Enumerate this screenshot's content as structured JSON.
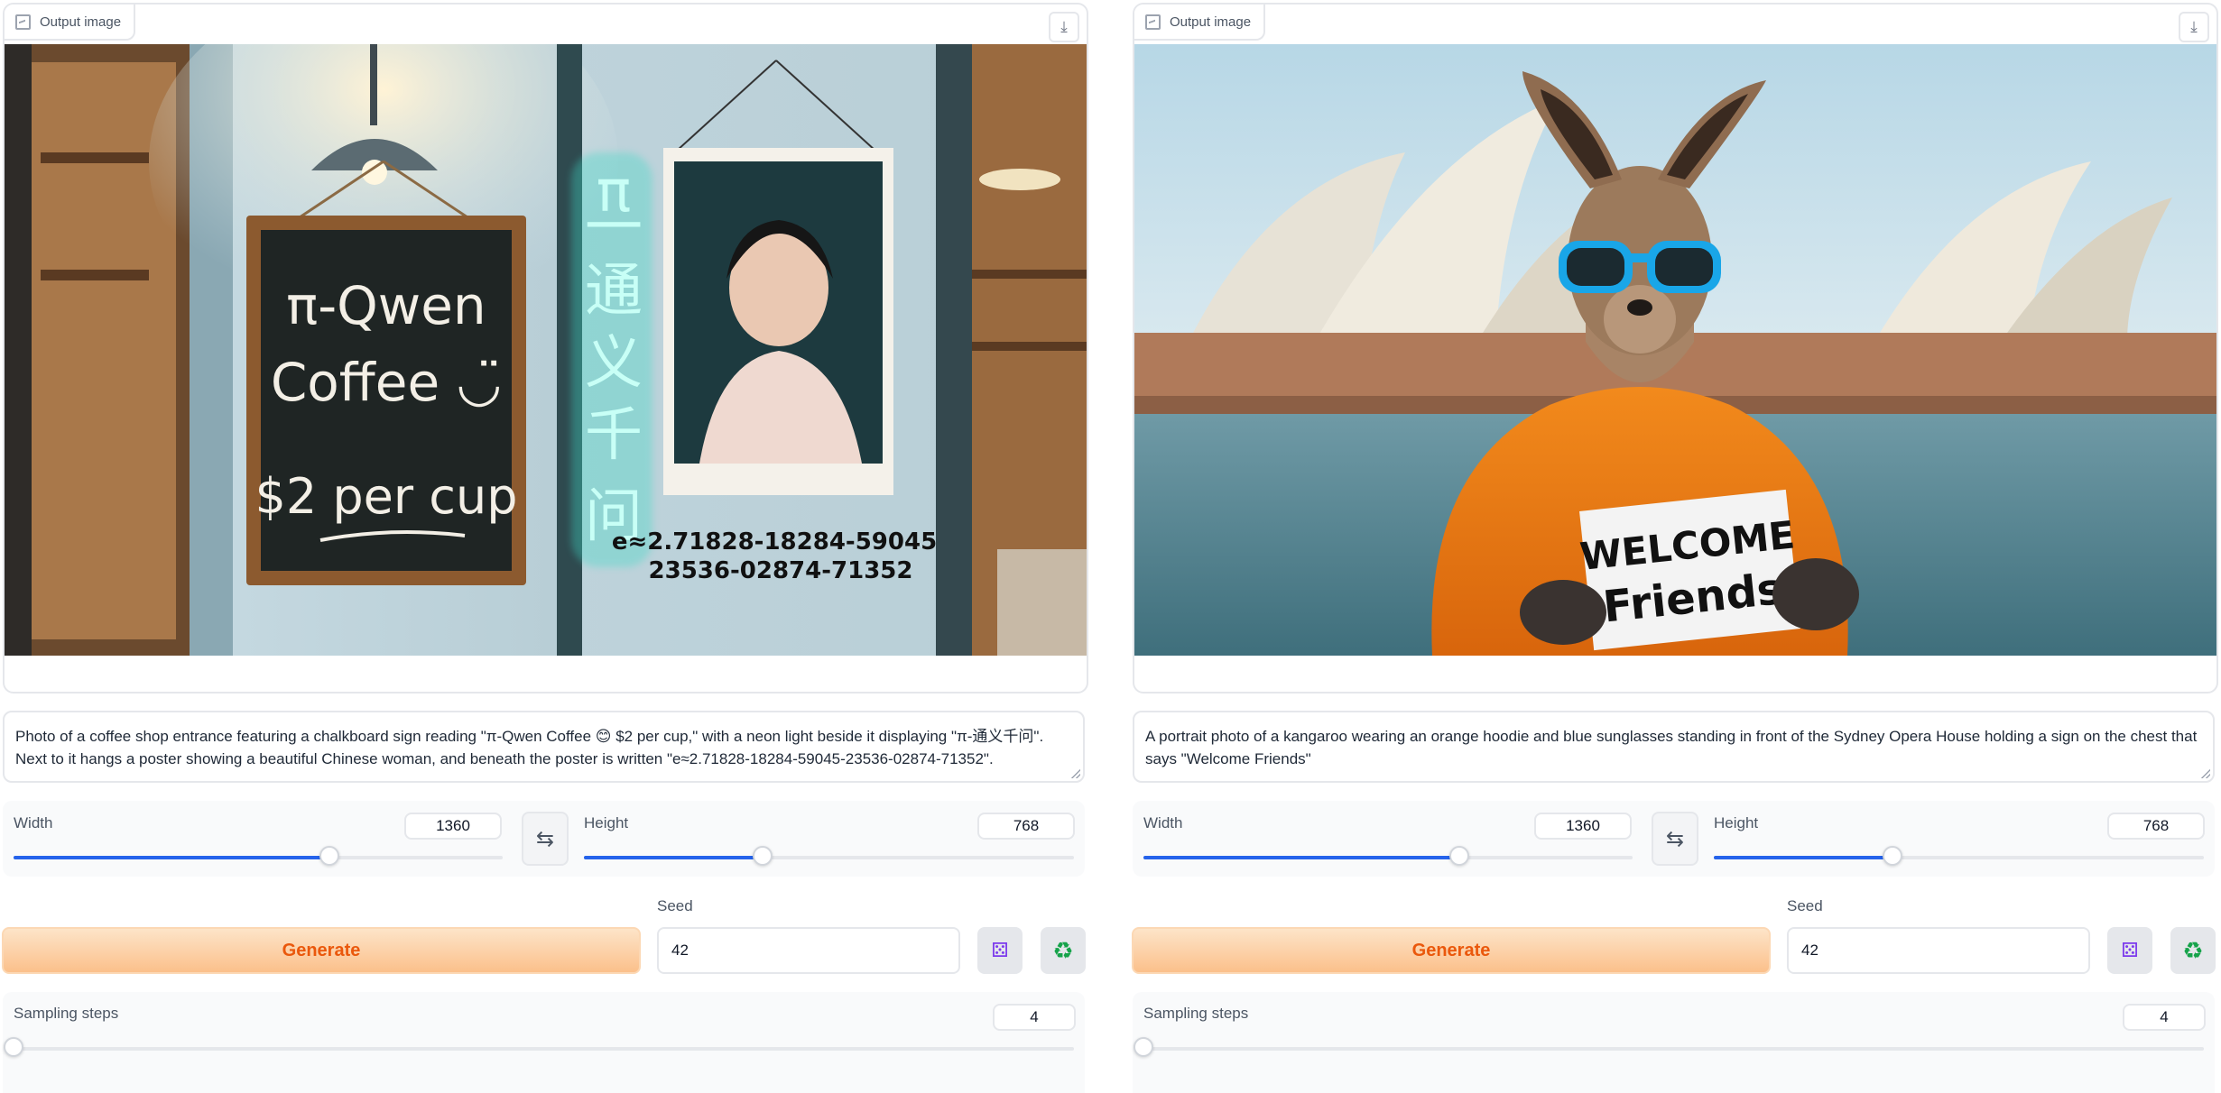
{
  "colors": {
    "accent": "#2563eb",
    "generate_text": "#ea580c",
    "generate_bg_top": "#fde4c8",
    "generate_bg_bottom": "#fbc08b"
  },
  "panels": [
    {
      "output": {
        "label": "Output image",
        "download_icon": "download-icon",
        "image_icon": "image-icon"
      },
      "prompt": "Photo of a coffee shop entrance featuring a chalkboard sign reading \"π-Qwen Coffee 😊 $2 per cup,\" with a neon light beside it displaying \"π-通义千问\". Next to it hangs a poster showing a beautiful Chinese woman, and beneath the poster is written \"e≈2.71828-18284-59045-23536-02874-71352\".",
      "image_text": {
        "board_line1": "π-Qwen",
        "board_line2": "Coffee ◡̈",
        "board_line3": "$2 per cup",
        "neon": [
          "π",
          "一",
          "通",
          "义",
          "千",
          "问"
        ],
        "e_line1": "e≈2.71828-18284-59045",
        "e_line2": "23536-02874-71352"
      },
      "width": {
        "label": "Width",
        "value": "1360",
        "fraction": 0.645
      },
      "height": {
        "label": "Height",
        "value": "768",
        "fraction": 0.365
      },
      "swap_icon": "swap-icon",
      "seed": {
        "label": "Seed",
        "value": "42"
      },
      "generate_label": "Generate",
      "dice_icon": "dice-icon",
      "recycle_icon": "recycle-icon",
      "steps": {
        "label": "Sampling steps",
        "value": "4",
        "fraction": 0.0
      }
    },
    {
      "output": {
        "label": "Output image",
        "download_icon": "download-icon",
        "image_icon": "image-icon"
      },
      "prompt": "A portrait photo of a kangaroo wearing an orange hoodie and blue sunglasses standing in front of the Sydney Opera House holding a sign on the chest that says \"Welcome Friends\"",
      "image_text": {
        "sign_line1": "WELCOME",
        "sign_line2": "Friends"
      },
      "width": {
        "label": "Width",
        "value": "1360",
        "fraction": 0.645
      },
      "height": {
        "label": "Height",
        "value": "768",
        "fraction": 0.365
      },
      "swap_icon": "swap-icon",
      "seed": {
        "label": "Seed",
        "value": "42"
      },
      "generate_label": "Generate",
      "dice_icon": "dice-icon",
      "recycle_icon": "recycle-icon",
      "steps": {
        "label": "Sampling steps",
        "value": "4",
        "fraction": 0.0
      }
    }
  ]
}
